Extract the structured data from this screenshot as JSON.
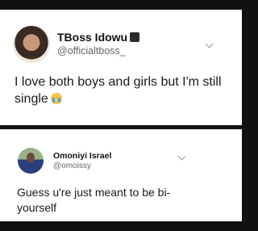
{
  "tweets": [
    {
      "name": "TBoss Idowu",
      "handle": "@officialtboss_",
      "text": "I love both boys and girls but I'm still single",
      "emoji": "crying-face-emoji"
    },
    {
      "name": "Omoniyi Israel",
      "handle": "@omoissy",
      "text": "Guess u're just meant to be bi- yourself"
    }
  ]
}
